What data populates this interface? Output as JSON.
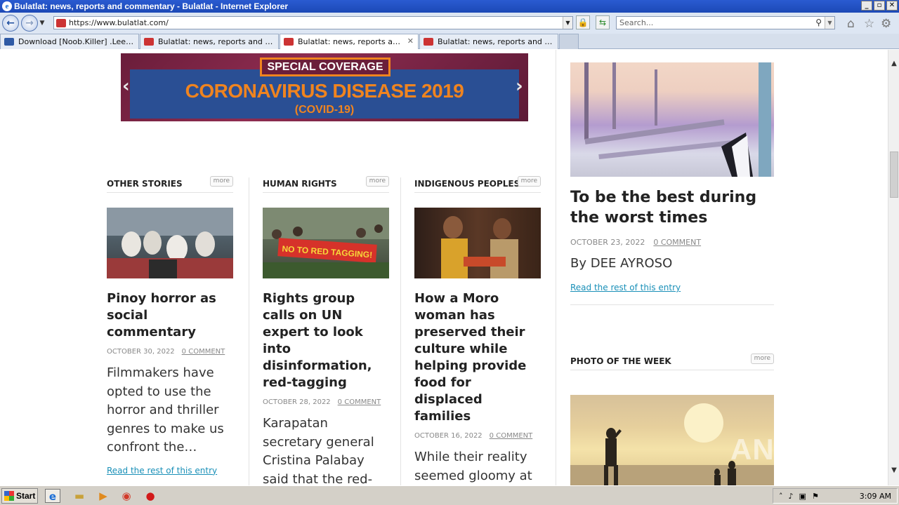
{
  "window": {
    "title": "Bulatlat: news, reports and commentary - Bulatlat - Internet Explorer",
    "minimize": "_",
    "restore": "▫",
    "close": "✕"
  },
  "address_bar": {
    "url": "https://www.bulatlat.com/",
    "search_placeholder": "Search..."
  },
  "tabs": [
    {
      "label": "Download [Noob.Killer] .Leerz b...",
      "active": false
    },
    {
      "label": "Bulatlat: news, reports and com...",
      "active": false
    },
    {
      "label": "Bulatlat: news, reports and ...",
      "active": true
    },
    {
      "label": "Bulatlat: news, reports and com...",
      "active": false
    }
  ],
  "banner": {
    "tag": "SPECIAL COVERAGE",
    "headline": "CORONAVIRUS DISEASE 2019",
    "sub": "(COVID-19)",
    "prev": "‹",
    "next": "›"
  },
  "columns": [
    {
      "section": "OTHER STORIES",
      "more": "more",
      "title": "Pinoy horror as social commentary",
      "date": "OCTOBER 30, 2022",
      "comments": "0 COMMENT",
      "excerpt": "Filmmakers have opted to use the horror and thriller genres to make us confront the…",
      "read_more": "Read the rest of this entry"
    },
    {
      "section": "HUMAN RIGHTS",
      "more": "more",
      "title": "Rights group calls on UN expert to look into disinformation, red-tagging",
      "date": "OCTOBER 28, 2022",
      "comments": "0 COMMENT",
      "excerpt": "Karapatan secretary general Cristina Palabay said that the red-tagging has",
      "image_text": "NO TO RED TAGGING!"
    },
    {
      "section": "INDIGENOUS PEOPLES",
      "more": "more",
      "title": "How a Moro woman has preserved their culture while helping provide food for displaced families",
      "date": "OCTOBER 16, 2022",
      "comments": "0 COMMENT",
      "excerpt": "While their reality seemed gloomy at the evacuation site, it"
    }
  ],
  "sidebar": {
    "feature_title": "To be the best during the worst times",
    "date": "OCTOBER 23, 2022",
    "comments": "0 COMMENT",
    "byline": "By DEE AYROSO",
    "read_more": "Read the rest of this entry",
    "photo_of_week": "PHOTO OF THE WEEK",
    "more": "more"
  },
  "watermark": "ANY RUN",
  "taskbar": {
    "start": "Start",
    "clock": "3:09 AM"
  }
}
